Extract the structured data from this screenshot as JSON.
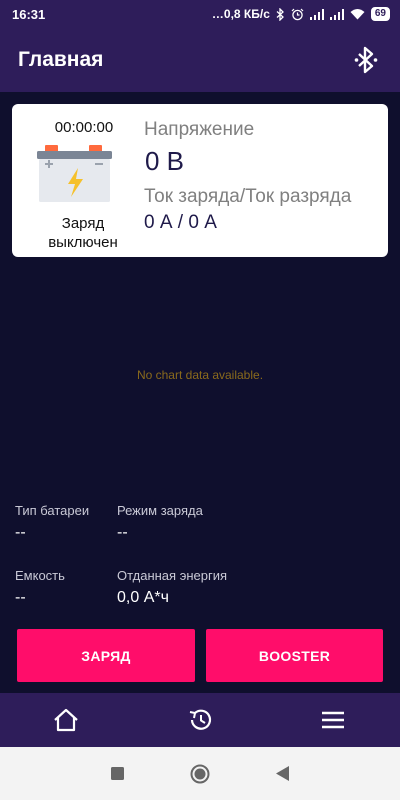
{
  "status_bar": {
    "time": "16:31",
    "net_speed": "…0,8 КБ/с",
    "battery": "69"
  },
  "app_bar": {
    "title": "Главная",
    "bluetooth_icon": "bluetooth-icon"
  },
  "card": {
    "timer": "00:00:00",
    "charge_status": "Заряд выключен",
    "voltage_label": "Напряжение",
    "voltage_value": "0 В",
    "current_label": "Ток заряда/Ток разряда",
    "current_value": "0 А / 0 А",
    "battery_icon": "battery-icon"
  },
  "chart": {
    "empty_text": "No chart data available."
  },
  "info": {
    "battery_type_label": "Тип батареи",
    "battery_type_value": "--",
    "charge_mode_label": "Режим заряда",
    "charge_mode_value": "--",
    "capacity_label": "Емкость",
    "capacity_value": "--",
    "energy_label": "Отданная энергия",
    "energy_value": "0,0 А*ч"
  },
  "buttons": {
    "charge": "ЗАРЯД",
    "booster": "BOOSTER"
  },
  "bottom_nav": {
    "items": [
      "home-icon",
      "history-icon",
      "menu-icon"
    ]
  },
  "system_nav": {
    "items": [
      "recents-icon",
      "home-circle-icon",
      "back-icon"
    ]
  },
  "colors": {
    "accent": "#ff0d6a",
    "appbar": "#2e1d5a",
    "background": "#0f0f2d"
  }
}
